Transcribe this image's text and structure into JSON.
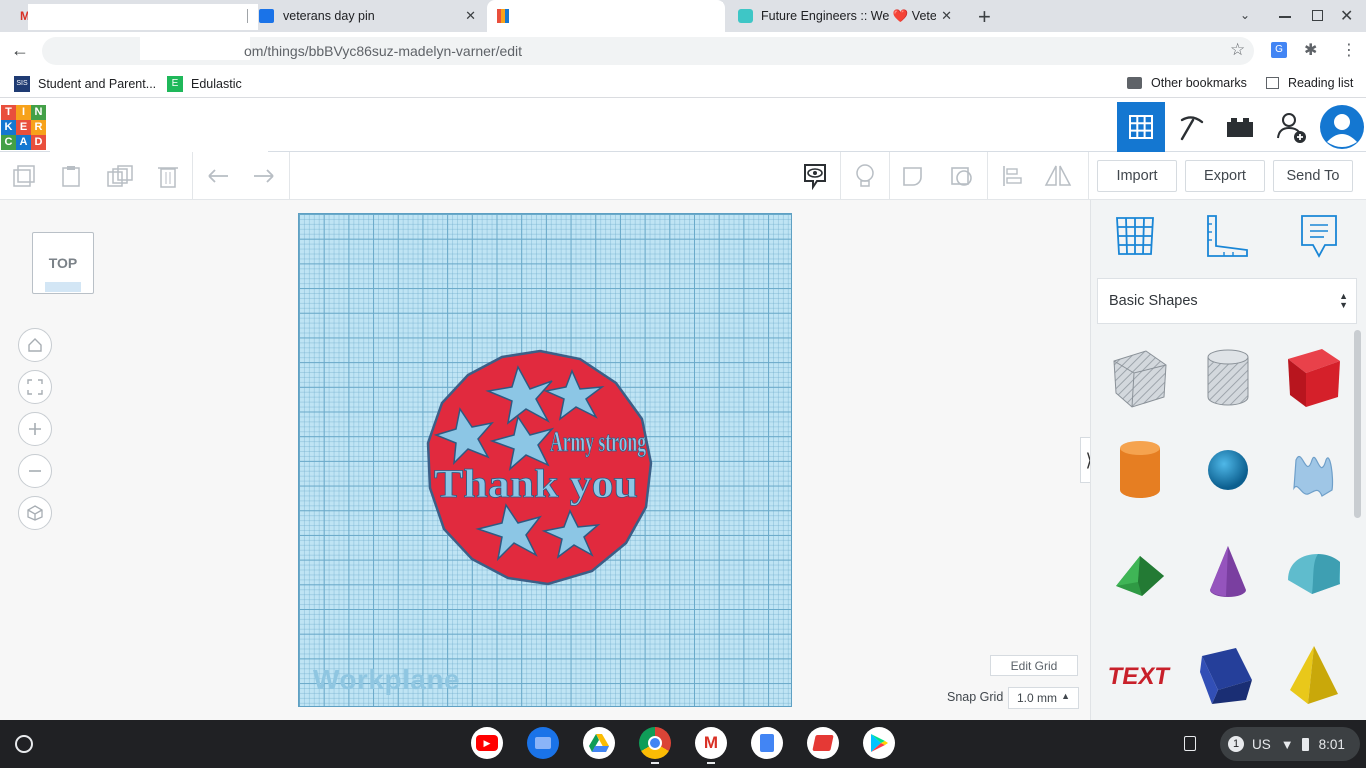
{
  "browser": {
    "tabs": [
      {
        "title": "",
        "icon": "gmail-icon"
      },
      {
        "title": "veterans day pin",
        "icon": "classroom-icon"
      },
      {
        "title": "",
        "icon": "tinkercad-favicon"
      },
      {
        "title": "Future Engineers :: We ❤️ Veterans",
        "icon": "future-engineers-icon"
      }
    ],
    "url": "om/things/bbBVyc86suz-madelyn-varner/edit",
    "bookmarks": [
      {
        "label": "Student and Parent...",
        "icon": "sis-icon"
      },
      {
        "label": "Edulastic",
        "icon": "edulastic-icon"
      }
    ],
    "other_bookmarks": "Other bookmarks",
    "reading_list": "Reading list"
  },
  "tinkercad": {
    "logo_letters": [
      "T",
      "I",
      "N",
      "K",
      "E",
      "R",
      "C",
      "A",
      "D"
    ],
    "header_icons": [
      "grid-view-icon",
      "pickaxe-icon",
      "bricks-icon",
      "add-user-icon",
      "user-avatar"
    ],
    "toolbar_buttons": [
      "copy",
      "paste",
      "duplicate",
      "delete",
      "undo",
      "redo",
      "notes",
      "light",
      "group",
      "ungroup",
      "align",
      "mirror"
    ],
    "import_label": "Import",
    "export_label": "Export",
    "send_to_label": "Send To",
    "view_cube_label": "TOP",
    "workplane_label": "Workplane",
    "design_text_1": "Army strong",
    "design_text_2": "Thank you",
    "edit_grid_label": "Edit Grid",
    "snap_grid_label": "Snap Grid",
    "snap_grid_value": "1.0 mm",
    "panel_icons": [
      "workplane-icon",
      "ruler-icon",
      "notes-icon"
    ],
    "shape_category": "Basic Shapes",
    "shapes": [
      {
        "name": "box-hole",
        "color": "#c0c6cc"
      },
      {
        "name": "cylinder-hole",
        "color": "#c0c6cc"
      },
      {
        "name": "box",
        "color": "#d5202a"
      },
      {
        "name": "cylinder",
        "color": "#e67e22"
      },
      {
        "name": "sphere",
        "color": "#1b8fc5"
      },
      {
        "name": "scribble",
        "color": "#9fc6e6"
      },
      {
        "name": "roof",
        "color": "#2f9a44"
      },
      {
        "name": "cone",
        "color": "#7a3fa0"
      },
      {
        "name": "round-roof",
        "color": "#5fbccd"
      },
      {
        "name": "text",
        "color": "#c8202a"
      },
      {
        "name": "wedge",
        "color": "#253f9a"
      },
      {
        "name": "pyramid",
        "color": "#e9c81a"
      }
    ],
    "colors": {
      "primary": "#1477d1",
      "design_red": "#e12a3e",
      "design_blue": "#8cc6e5"
    }
  },
  "os": {
    "apps": [
      "youtube-icon",
      "files-icon",
      "drive-icon",
      "chrome-icon",
      "gmail-icon",
      "docs-icon",
      "screencastify-icon",
      "play-store-icon"
    ],
    "keyboard": "US",
    "notification_count": "1",
    "time": "8:01"
  }
}
